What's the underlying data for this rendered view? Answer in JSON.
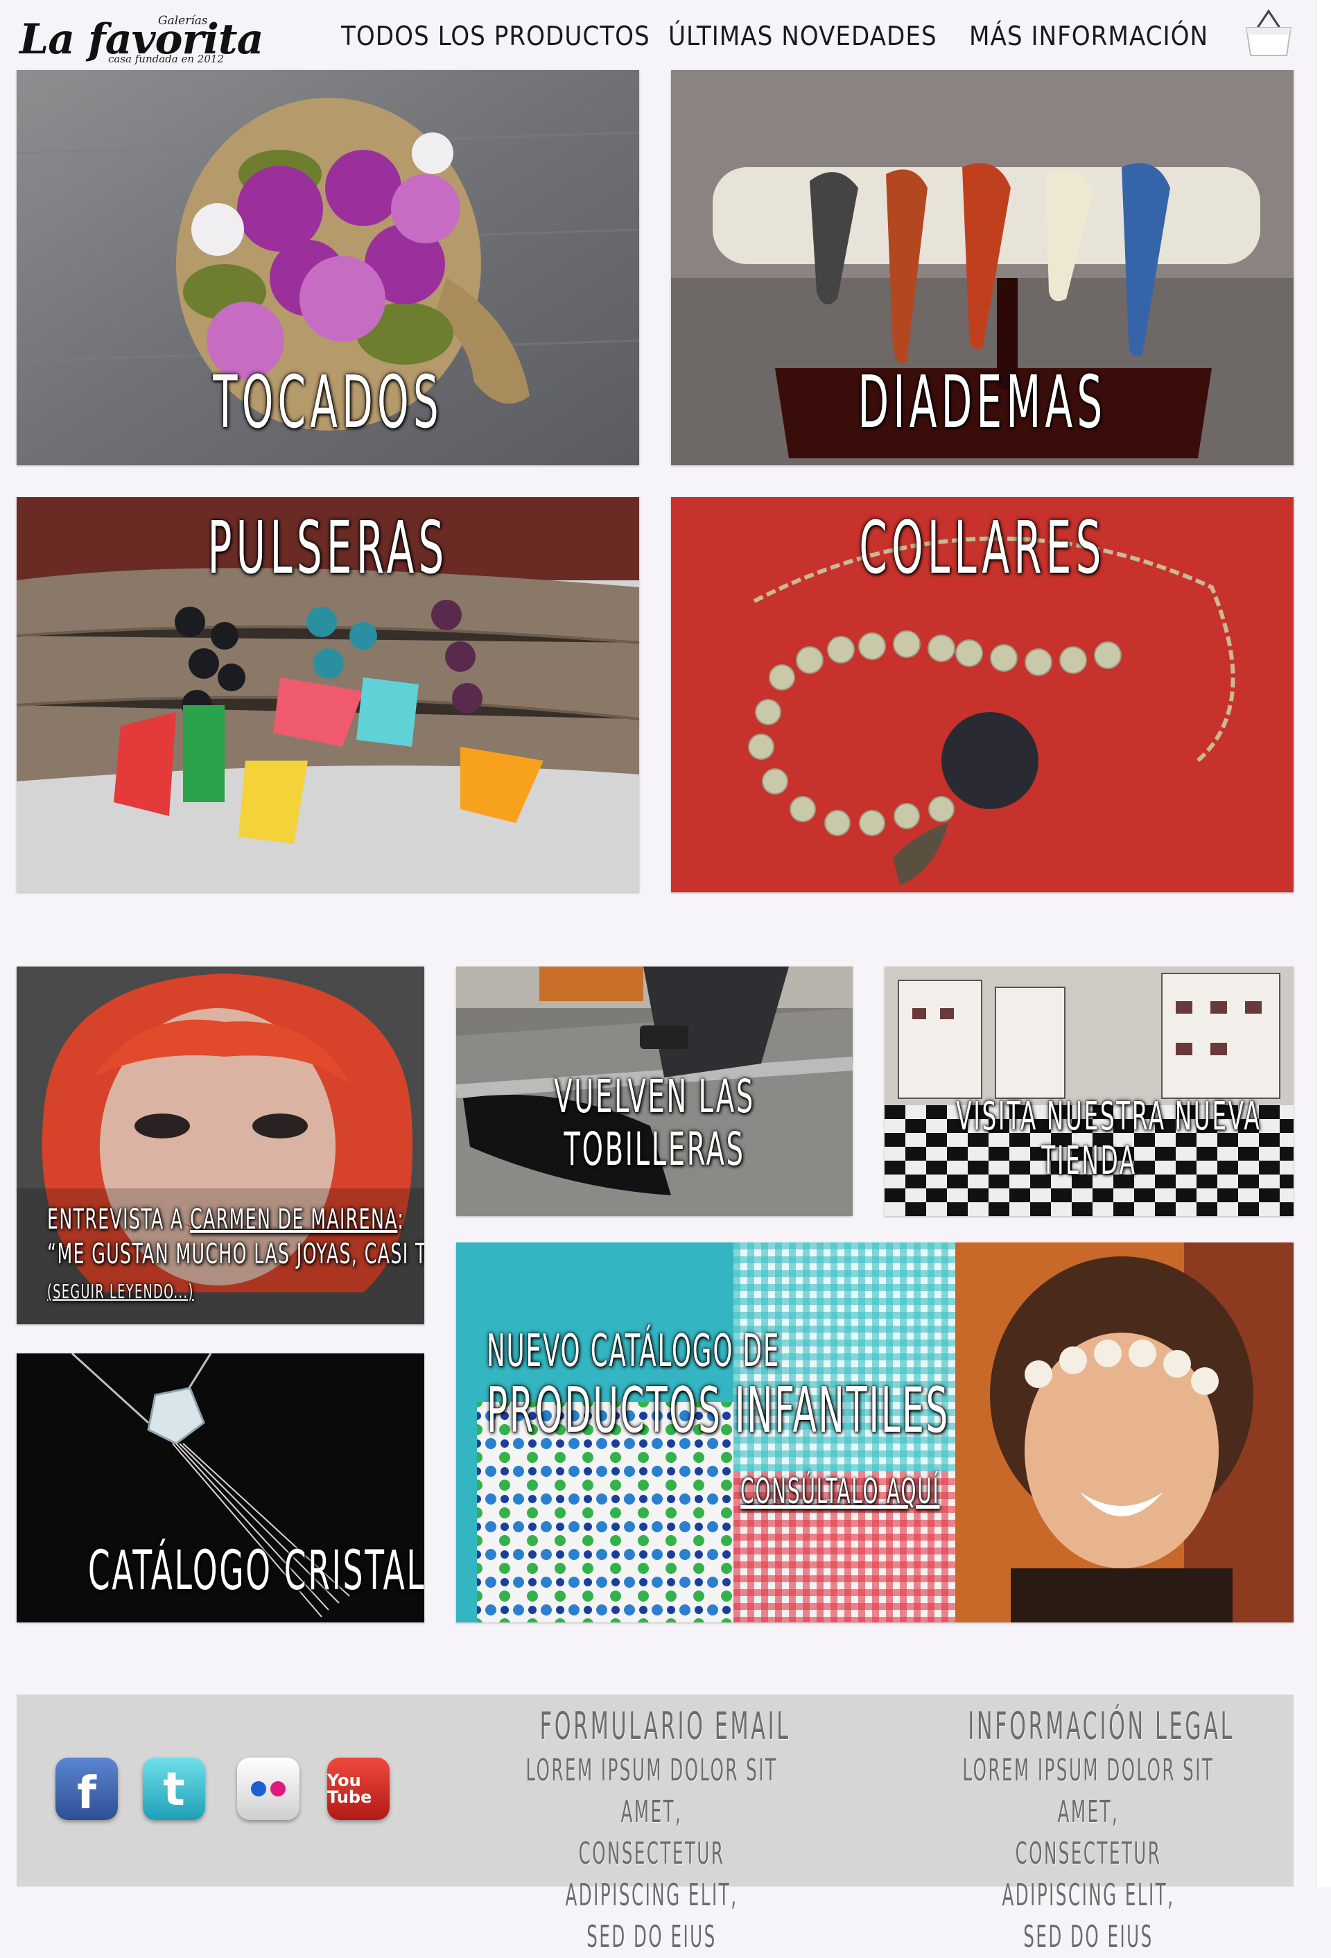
{
  "header": {
    "logo_small": "Galerías",
    "logo_main": "La favorita",
    "logo_tagline": "casa fundada en 2012",
    "nav": [
      "Todos los productos",
      "Últimas novedades",
      "Más información"
    ]
  },
  "categories": [
    {
      "label": "Tocados"
    },
    {
      "label": "Diademas"
    },
    {
      "label": "Pulseras"
    },
    {
      "label": "Collares"
    }
  ],
  "features": {
    "interview": {
      "prefix": "Entrevista a",
      "name": "Carmen de Mairena",
      "colon": ":",
      "quote": "“Me gustan mucho las joyas, casi tanto como las...",
      "more": "(seguir leyendo...)"
    },
    "anklets": {
      "line1": "Vuelven las",
      "line2": "tobilleras"
    },
    "store": {
      "line1": "Visita nuestra nueva",
      "line2": "tienda"
    },
    "crystal": {
      "label": "Catálogo cristal"
    },
    "kids": {
      "line1": "Nuevo catálogo de",
      "line2": "productos infantiles",
      "link": "Consúltalo aquí"
    }
  },
  "footer": {
    "social": [
      {
        "name": "Facebook",
        "glyph": "f",
        "color": "#3a5fa8"
      },
      {
        "name": "Twitter",
        "glyph": "t",
        "color": "#33b5cf"
      },
      {
        "name": "Flickr",
        "glyph": "••",
        "color": "#e8e8e8"
      },
      {
        "name": "YouTube",
        "glyph": "You Tube",
        "color": "#d52b1e"
      }
    ],
    "email": {
      "title": "Formulario email",
      "body": [
        "Lorem ipsum dolor sit amet,",
        "consectetur adipiscing elit,",
        "sed do eius"
      ]
    },
    "legal": {
      "title": "Información legal",
      "body": [
        "Lorem ipsum dolor sit amet,",
        "consectetur adipiscing elit,",
        "sed do eius"
      ]
    }
  }
}
